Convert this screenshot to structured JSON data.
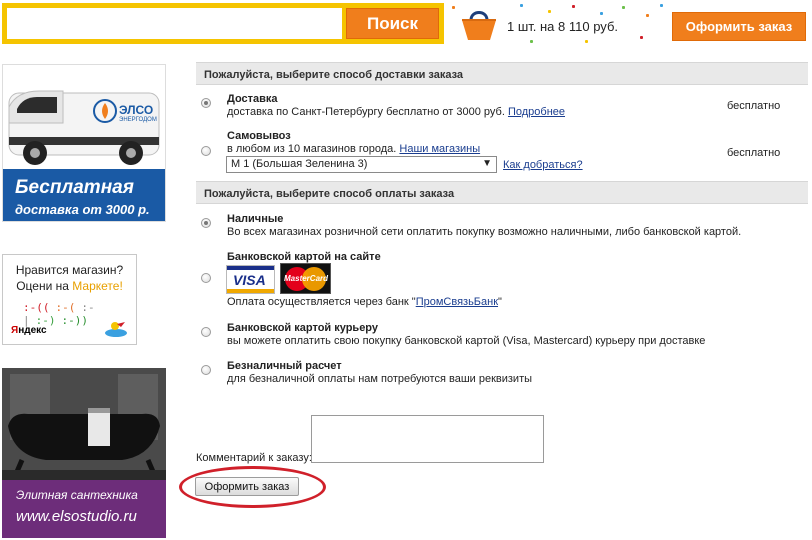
{
  "header": {
    "search_placeholder": "",
    "search_button": "Поиск",
    "cart_summary": "1 шт. на 8 110 руб.",
    "checkout_button": "Оформить заказ"
  },
  "banners": {
    "van": {
      "brand": "ЭЛСО",
      "brand_sub": "ЭНЕРГОДОМ",
      "line1": "Бесплатная",
      "line2": "доставка от 3000 р."
    },
    "market": {
      "line1": "Нравится магазин?",
      "line2_prefix": "Оцени на ",
      "line2_link": "Маркете!",
      "smiles": [
        ":-((",
        ":-(",
        ":-|",
        ":-)",
        ":-))"
      ],
      "yandex_y": "Я",
      "yandex_rest": "ндекс"
    },
    "bath": {
      "line1": "Элитная сантехника",
      "line2": "www.elsostudio.ru"
    }
  },
  "delivery": {
    "heading": "Пожалуйста, выберите способ доставки заказа",
    "options": [
      {
        "title": "Доставка",
        "desc": "доставка по Санкт-Петербургу бесплатно от 3000 руб.",
        "link": "Подробнее",
        "price": "бесплатно",
        "checked": true
      },
      {
        "title": "Самовывоз",
        "desc": "в любом из 10 магазинов города.",
        "link": "Наши магазины",
        "price": "бесплатно",
        "checked": false,
        "store_selected": "М 1 (Большая Зеленина 3)",
        "directions_link": "Как добраться?"
      }
    ]
  },
  "payment": {
    "heading": "Пожалуйста, выберите способ оплаты заказа",
    "options": [
      {
        "title": "Наличные",
        "desc": "Во всех магазинах розничной сети оплатить покупку возможно наличными, либо банковской картой.",
        "checked": true
      },
      {
        "title": "Банковской картой на сайте",
        "desc_prefix": "Оплата осуществляется через банк \"",
        "bank_link": "ПромСвязьБанк",
        "desc_suffix": "\"",
        "visa": "VISA",
        "mastercard": "MasterCard",
        "checked": false
      },
      {
        "title": "Банковской картой курьеру",
        "desc": "вы можете оплатить свою покупку банковской картой (Visa, Mastercard) курьеру при доставке",
        "checked": false
      },
      {
        "title": "Безналичный расчет",
        "desc": "для безналичной оплаты нам потребуются ваши реквизиты",
        "checked": false
      }
    ]
  },
  "comment": {
    "label": "Комментарий к заказу:",
    "value": ""
  },
  "submit_button": "Оформить заказ",
  "colors": {
    "accent_orange": "#f07e1c",
    "search_frame": "#f5c400",
    "link": "#1a3d8f",
    "highlight_ellipse": "#d0202a"
  }
}
